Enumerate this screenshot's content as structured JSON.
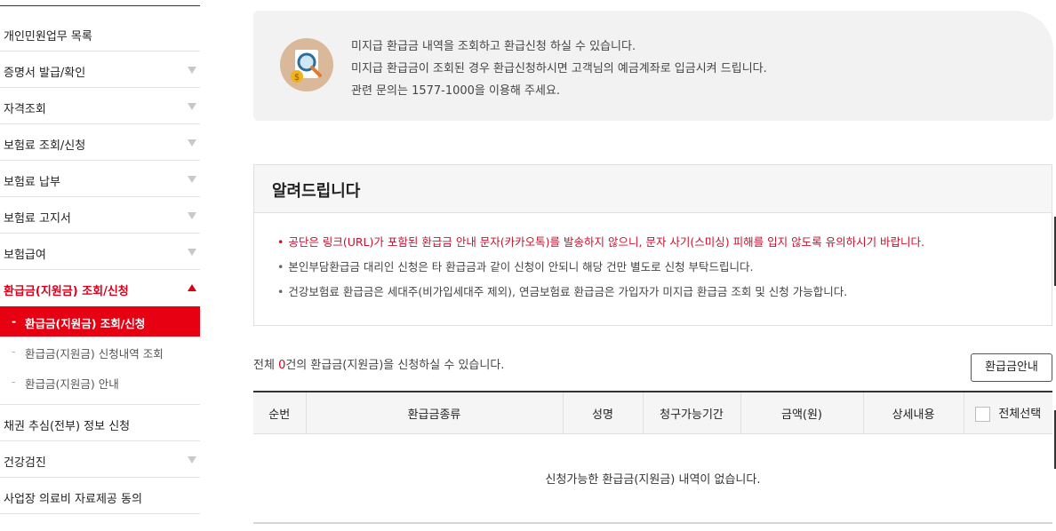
{
  "sidebar": {
    "items": [
      {
        "label": "개인민원업무 목록",
        "arrow": "none"
      },
      {
        "label": "증명서 발급/확인",
        "arrow": "down"
      },
      {
        "label": "자격조회",
        "arrow": "down"
      },
      {
        "label": "보험료 조회/신청",
        "arrow": "down"
      },
      {
        "label": "보험료 납부",
        "arrow": "down"
      },
      {
        "label": "보험료 고지서",
        "arrow": "down"
      },
      {
        "label": "보험급여",
        "arrow": "down"
      }
    ],
    "active": {
      "label": "환급금(지원금) 조회/신청",
      "sub": [
        {
          "label": "환급금(지원금) 조회/신청",
          "dash": "-"
        },
        {
          "label": "환급금(지원금) 신청내역 조회",
          "dash": "-"
        },
        {
          "label": "환급금(지원금) 안내",
          "dash": "-"
        }
      ]
    },
    "after": [
      {
        "label": "채권 추심(전부) 정보 신청",
        "arrow": "none"
      },
      {
        "label": "건강검진",
        "arrow": "down"
      },
      {
        "label": "사업장 의료비 자료제공 동의",
        "arrow": "none"
      }
    ]
  },
  "info": {
    "icon": "magnifier-coin-icon",
    "lines": [
      "미지급 환급금 내역을 조회하고 환급신청 하실 수 있습니다.",
      "미지급 환급금이 조회된 경우 환급신청하시면 고객님의 예금계좌로 입금시켜 드립니다.",
      "관련 문의는 1577-1000을 이용해 주세요."
    ]
  },
  "notice": {
    "title": "알려드립니다",
    "bullet": "•",
    "items": [
      "공단은 링크(URL)가 포함된 환급금 안내 문자(카카오톡)를 발송하지 않으니, 문자 사기(스미싱) 피해를 입지 않도록 유의하시기 바랍니다.",
      "본인부담환급금 대리인 신청은 타 환급금과 같이 신청이 안되니 해당 건만 별도로 신청 부탁드립니다.",
      "건강보험료 환급금은 세대주(비가입세대주 제외), 연금보험료 환급금은 가입자가 미지급 환급금 조회 및 신청 가능합니다."
    ]
  },
  "summary": {
    "prefix": "전체 ",
    "count": "0",
    "suffix": "건의 환급금(지원금)을 신청하실 수 있습니다."
  },
  "guide_button": "환급금안내",
  "table": {
    "headers": [
      "순번",
      "환급금종류",
      "성명",
      "청구가능기간",
      "금액(원)",
      "상세내용",
      "전체선택"
    ],
    "empty": "신청가능한 환급금(지원금) 내역이 없습니다."
  },
  "colors": {
    "accent": "#e60012",
    "notice_red": "#c8102e"
  }
}
